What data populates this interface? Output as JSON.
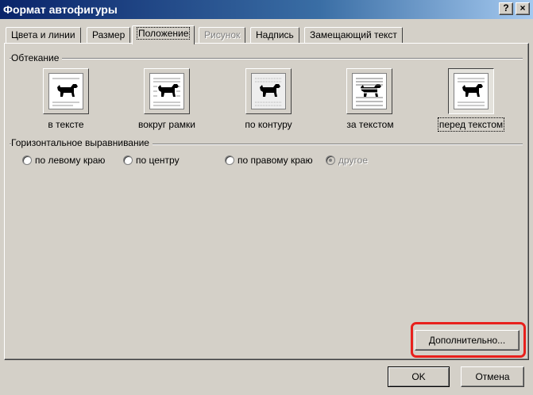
{
  "window": {
    "title": "Формат автофигуры",
    "help_glyph": "?",
    "close_glyph": "×"
  },
  "tabs": [
    {
      "label": "Цвета и линии",
      "state": "normal"
    },
    {
      "label": "Размер",
      "state": "normal"
    },
    {
      "label": "Положение",
      "state": "active"
    },
    {
      "label": "Рисунок",
      "state": "disabled"
    },
    {
      "label": "Надпись",
      "state": "normal"
    },
    {
      "label": "Замещающий текст",
      "state": "normal"
    }
  ],
  "wrapping": {
    "group_label": "Обтекание",
    "selected": "перед текстом",
    "options": [
      {
        "label": "в тексте",
        "icon": "wrap-inline-icon"
      },
      {
        "label": "вокруг рамки",
        "icon": "wrap-square-icon"
      },
      {
        "label": "по контуру",
        "icon": "wrap-tight-icon"
      },
      {
        "label": "за текстом",
        "icon": "wrap-behind-icon"
      },
      {
        "label": "перед текстом",
        "icon": "wrap-front-icon"
      }
    ]
  },
  "horizontal_alignment": {
    "group_label": "Горизонтальное выравнивание",
    "options": [
      {
        "label": "по левому краю",
        "disabled": false
      },
      {
        "label": "по центру",
        "disabled": false
      },
      {
        "label": "по правому краю",
        "disabled": false
      },
      {
        "label": "другое",
        "disabled": true
      }
    ]
  },
  "buttons": {
    "advanced": "Дополнительно...",
    "ok": "OK",
    "cancel": "Отмена"
  },
  "colors": {
    "highlight": "#e8201c",
    "titlebar_start": "#0a246a",
    "face": "#d4d0c8"
  }
}
